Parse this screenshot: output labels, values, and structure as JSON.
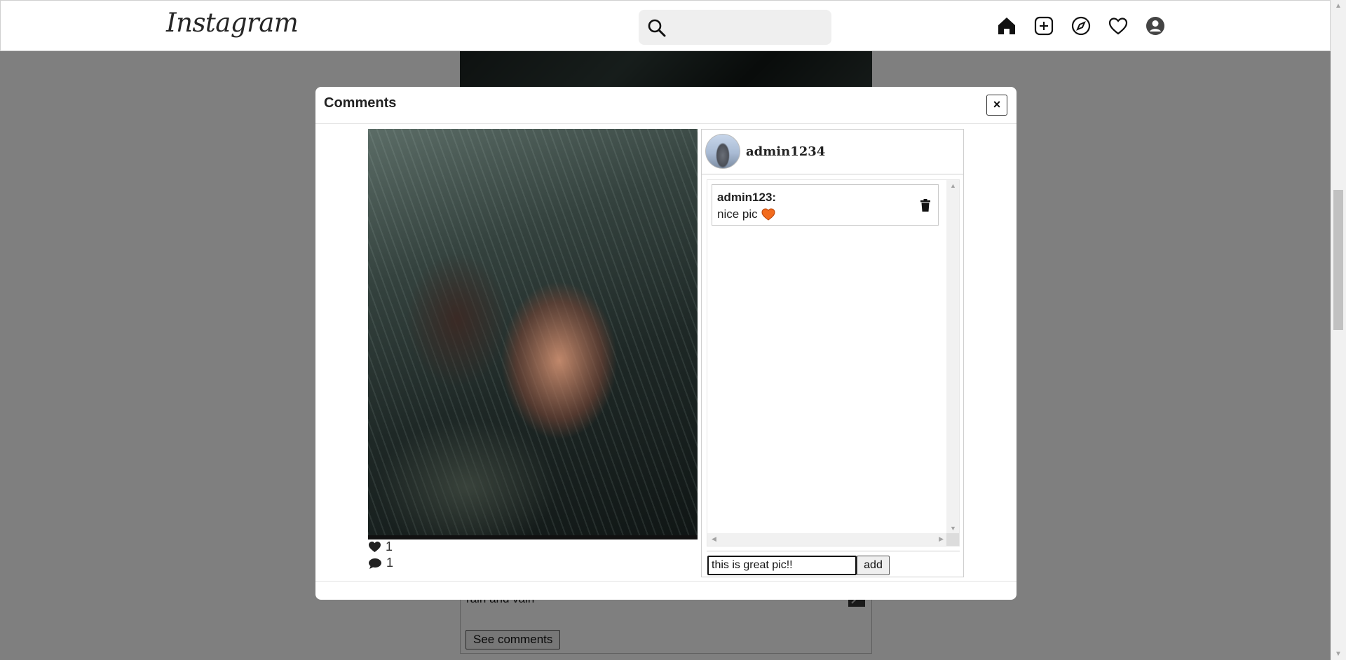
{
  "navbar": {
    "logo": "Instagram",
    "search_placeholder": "",
    "icons": [
      "home-icon",
      "add-post-icon",
      "explore-icon",
      "heart-icon",
      "profile-icon"
    ]
  },
  "feed": {
    "caption": "rain and vain",
    "see_comments_label": "See comments"
  },
  "modal": {
    "title": "Comments",
    "close_label": "×",
    "post": {
      "likes_count": "1",
      "comments_count": "1",
      "author": "admin1234"
    },
    "comments": [
      {
        "author": "admin123:",
        "text": "nice pic",
        "emoji": "orange-heart-icon"
      }
    ],
    "input_value": "this is great pic!!",
    "add_label": "add"
  },
  "colors": {
    "overlay": "rgba(0,0,0,0.5)",
    "heart_emoji": "#f26b1d",
    "text": "#222222"
  }
}
